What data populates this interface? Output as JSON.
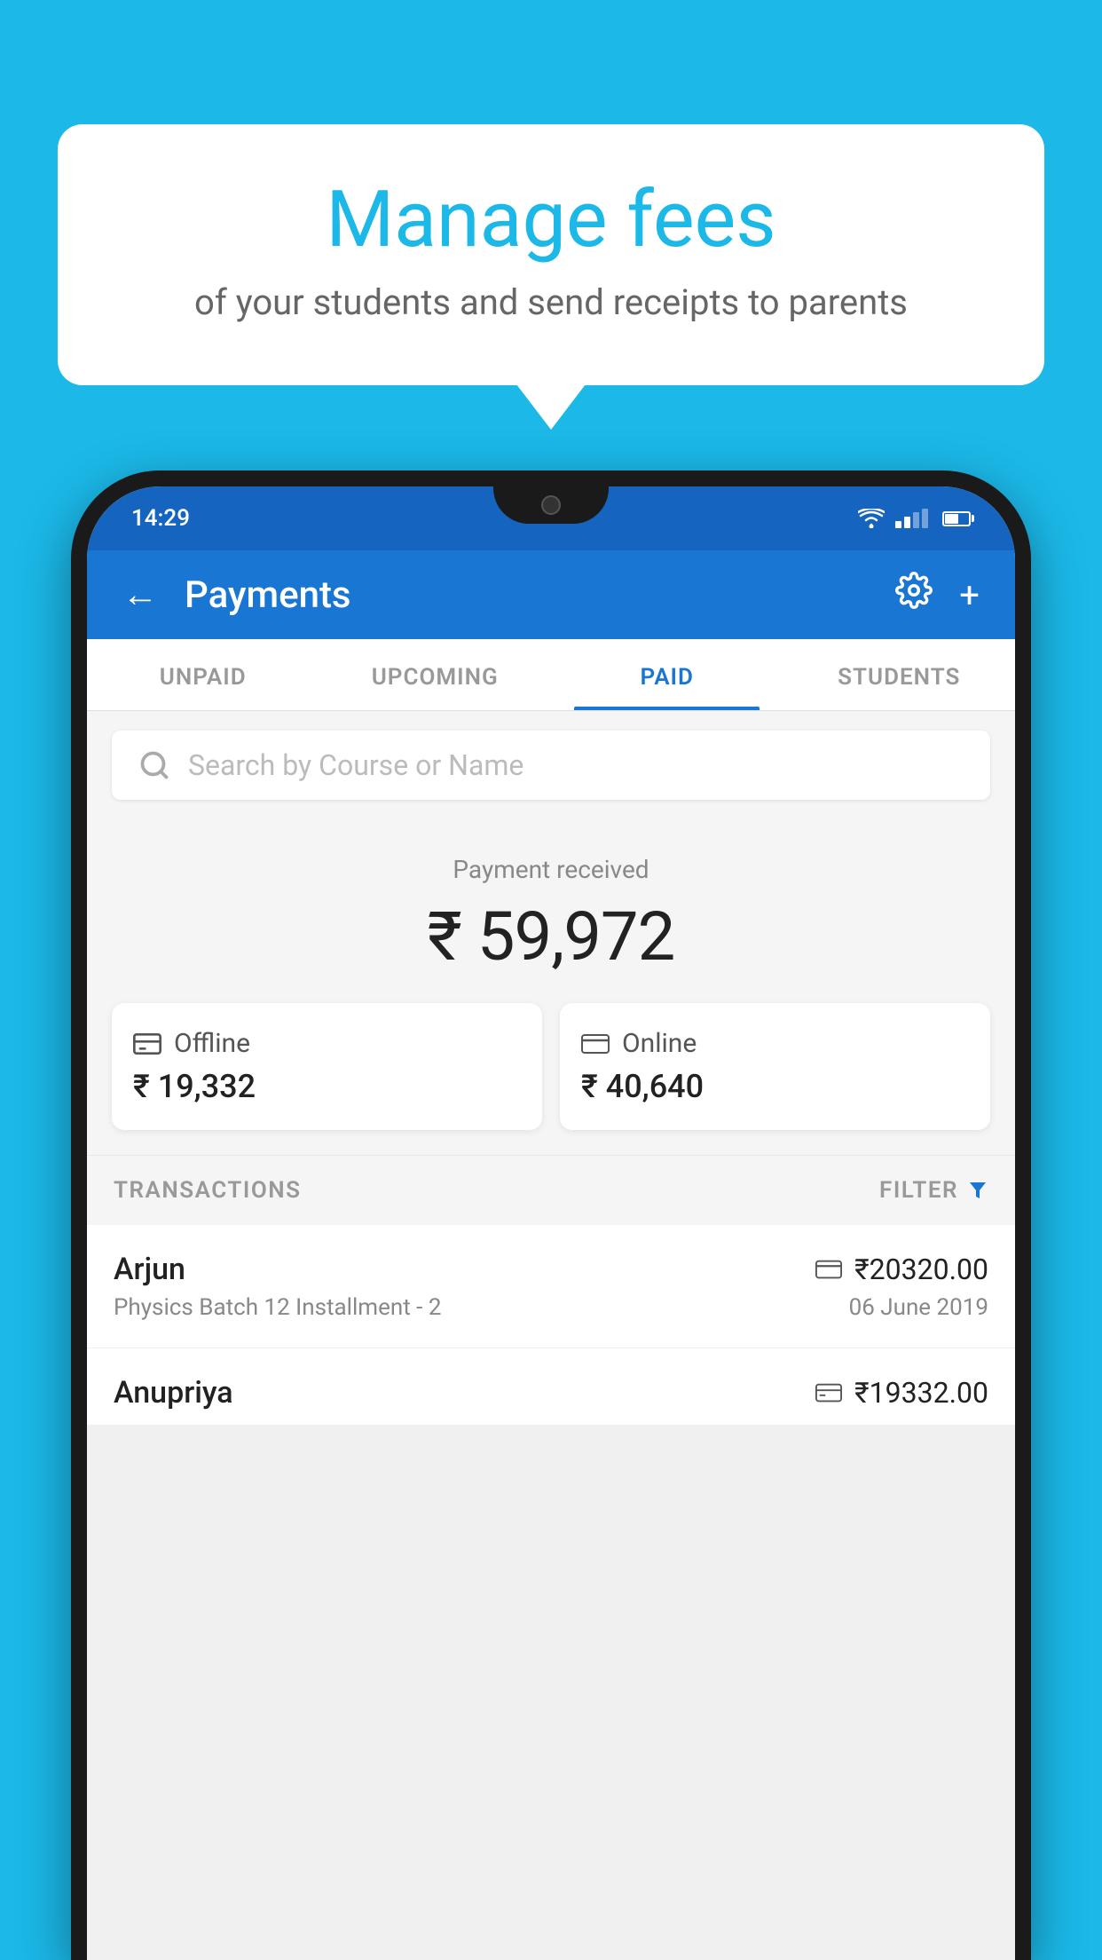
{
  "page": {
    "background_color": "#1bb8e8"
  },
  "speech_bubble": {
    "title": "Manage fees",
    "subtitle": "of your students and send receipts to parents"
  },
  "status_bar": {
    "time": "14:29"
  },
  "app_header": {
    "title": "Payments",
    "back_label": "←",
    "gear_label": "⚙",
    "plus_label": "+"
  },
  "tabs": [
    {
      "label": "UNPAID",
      "active": false
    },
    {
      "label": "UPCOMING",
      "active": false
    },
    {
      "label": "PAID",
      "active": true
    },
    {
      "label": "STUDENTS",
      "active": false
    }
  ],
  "search": {
    "placeholder": "Search by Course or Name"
  },
  "payment_section": {
    "label": "Payment received",
    "amount": "₹ 59,972",
    "offline": {
      "label": "Offline",
      "amount": "₹ 19,332"
    },
    "online": {
      "label": "Online",
      "amount": "₹ 40,640"
    }
  },
  "transactions": {
    "label": "TRANSACTIONS",
    "filter_label": "FILTER",
    "rows": [
      {
        "name": "Arjun",
        "course": "Physics Batch 12 Installment - 2",
        "amount": "₹20320.00",
        "date": "06 June 2019",
        "payment_type": "online"
      },
      {
        "name": "Anupriya",
        "course": "",
        "amount": "₹19332.00",
        "date": "",
        "payment_type": "offline"
      }
    ]
  }
}
